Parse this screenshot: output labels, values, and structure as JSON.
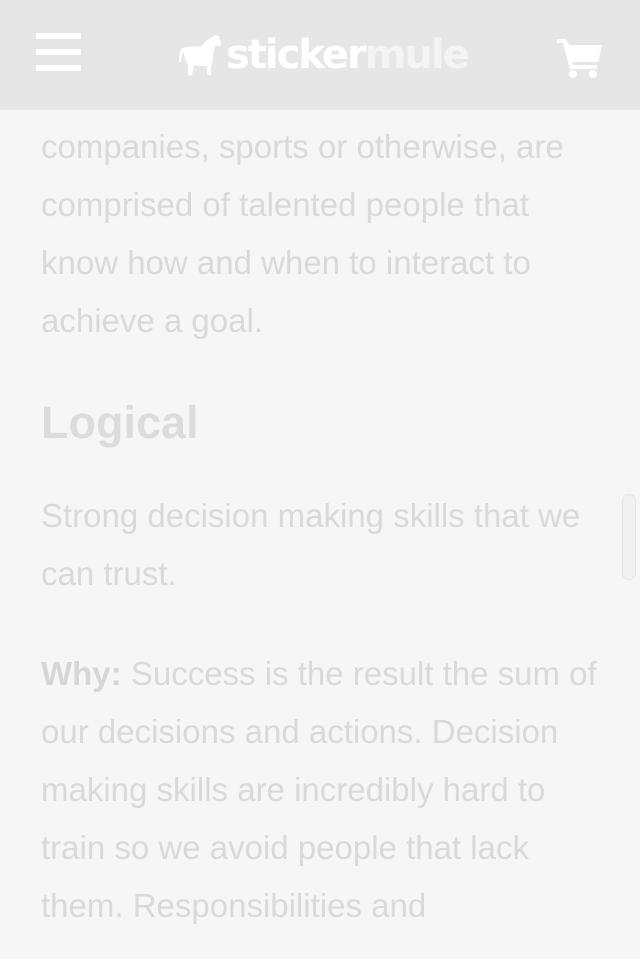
{
  "header": {
    "logo_word_1": "sticker",
    "logo_word_2": "mule"
  },
  "icons": {
    "menu": "hamburger-menu-icon",
    "logo": "mule-logo-icon",
    "cart": "shopping-cart-icon"
  },
  "colors": {
    "header_bg": "#e6e6e6",
    "page_bg": "#f6f6f6",
    "text": "#d9d9d9",
    "icon": "#ffffff"
  },
  "content": {
    "intro_paragraph": "companies, sports or otherwise, are comprised of talented people that know how and when to interact to achieve a goal.",
    "logical_heading": "Logical",
    "logical_paragraph": "Strong decision making skills that we can trust.",
    "why_label": "Why:",
    "why_paragraph": " Success is the result the sum of our decisions and actions. Decision making skills are incredibly hard to train so we avoid people that lack them. Responsibilities and"
  }
}
